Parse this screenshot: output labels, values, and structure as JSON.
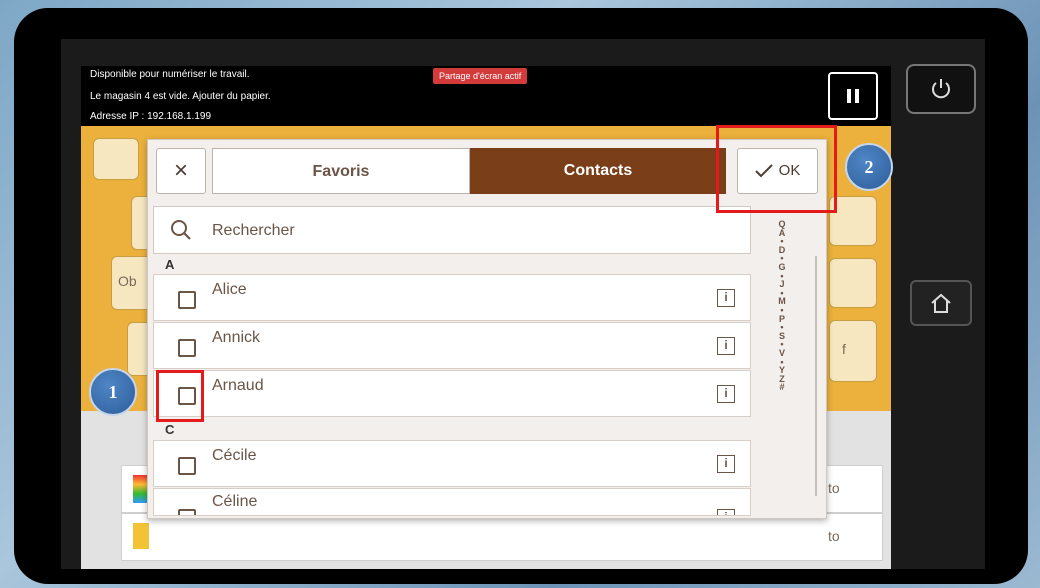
{
  "status": {
    "line1": "Disponible pour numériser le travail.",
    "line2": "Le magasin 4 est vide.  Ajouter du papier.",
    "line3": "Adresse IP : 192.168.1.199",
    "share_badge": "Partage d'écran actif"
  },
  "icons": {
    "power": "power-icon",
    "home": "home-icon",
    "pause": "pause-icon",
    "close": "close-icon",
    "check": "check-icon",
    "search": "search-icon",
    "info": "info-icon"
  },
  "background_app": {
    "left_labels": [
      "Ob"
    ],
    "right_labels": [
      "f",
      "to",
      "to"
    ]
  },
  "dialog": {
    "close_label": "×",
    "tabs": [
      {
        "label": "Favoris",
        "active": false
      },
      {
        "label": "Contacts",
        "active": true
      }
    ],
    "ok_label": "OK",
    "search_placeholder": "Rechercher",
    "sections": [
      {
        "letter": "A",
        "contacts": [
          "Alice",
          "Annick",
          "Arnaud"
        ]
      },
      {
        "letter": "C",
        "contacts": [
          "Cécile",
          "Céline"
        ]
      }
    ],
    "alpha_index": [
      "Q",
      "A",
      "•",
      "D",
      "•",
      "G",
      "•",
      "J",
      "•",
      "M",
      "•",
      "P",
      "•",
      "S",
      "•",
      "V",
      "•",
      "Y",
      "Z",
      "#"
    ],
    "info_glyph": "i"
  },
  "annotations": {
    "callout1": "1",
    "callout2": "2",
    "accent_red": "#e31b1b",
    "accent_brown": "#7a3f18"
  }
}
